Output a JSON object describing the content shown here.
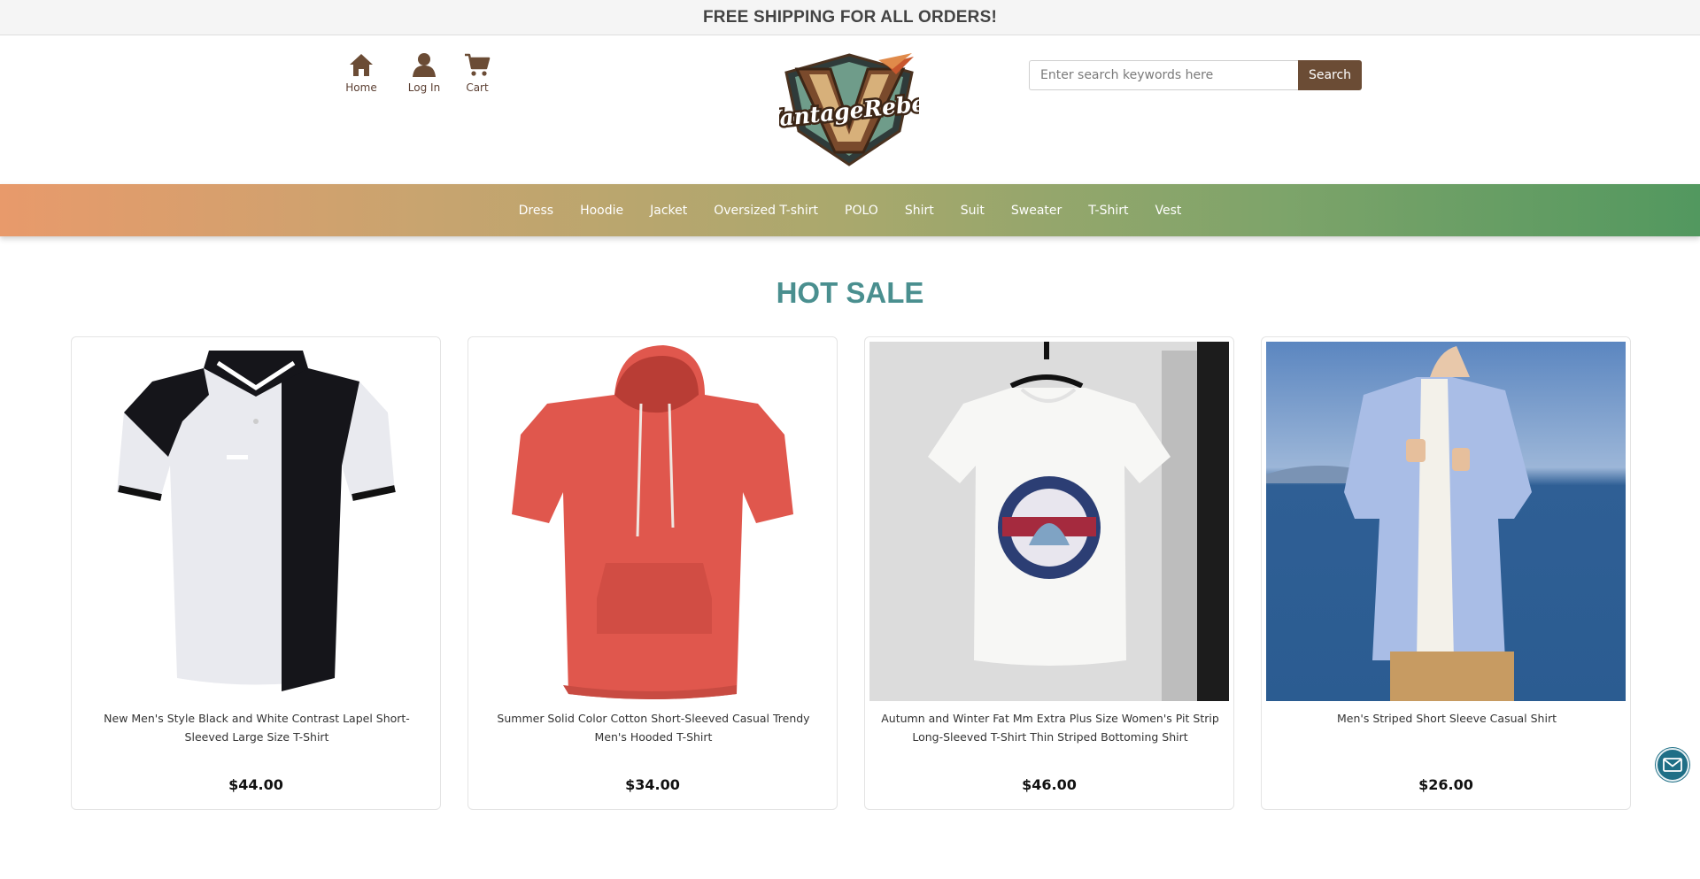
{
  "announcement": "FREE SHIPPING FOR ALL ORDERS!",
  "header": {
    "nav": [
      {
        "label": "Home",
        "icon": "home-icon"
      },
      {
        "label": "Log In",
        "icon": "user-icon"
      },
      {
        "label": "Cart",
        "icon": "cart-icon"
      }
    ],
    "logo_text": "VantageRebel",
    "search": {
      "placeholder": "Enter search keywords here",
      "value": "",
      "button_label": "Search"
    }
  },
  "categories": [
    "Dress",
    "Hoodie",
    "Jacket",
    "Oversized T-shirt",
    "POLO",
    "Shirt",
    "Suit",
    "Sweater",
    "T-Shirt",
    "Vest"
  ],
  "section": {
    "title": "HOT SALE"
  },
  "products": [
    {
      "title": "New Men's Style Black and White Contrast Lapel Short-Sleeved Large Size T-Shirt",
      "price": "$44.00"
    },
    {
      "title": "Summer Solid Color Cotton Short-Sleeved Casual Trendy Men's Hooded T-Shirt",
      "price": "$34.00"
    },
    {
      "title": "Autumn and Winter Fat Mm Extra Plus Size Women's Pit Strip Long-Sleeved T-Shirt Thin Striped Bottoming Shirt",
      "price": "$46.00"
    },
    {
      "title": "Men's Striped Short Sleeve Casual Shirt",
      "price": "$26.00"
    }
  ],
  "colors": {
    "accent_brown": "#6b4c35",
    "title_teal": "#4a8f8f",
    "gradient_start": "#e89a6b",
    "gradient_end": "#52985f",
    "mail_button": "#1f6f86"
  },
  "floating": {
    "icon": "mail-icon"
  }
}
